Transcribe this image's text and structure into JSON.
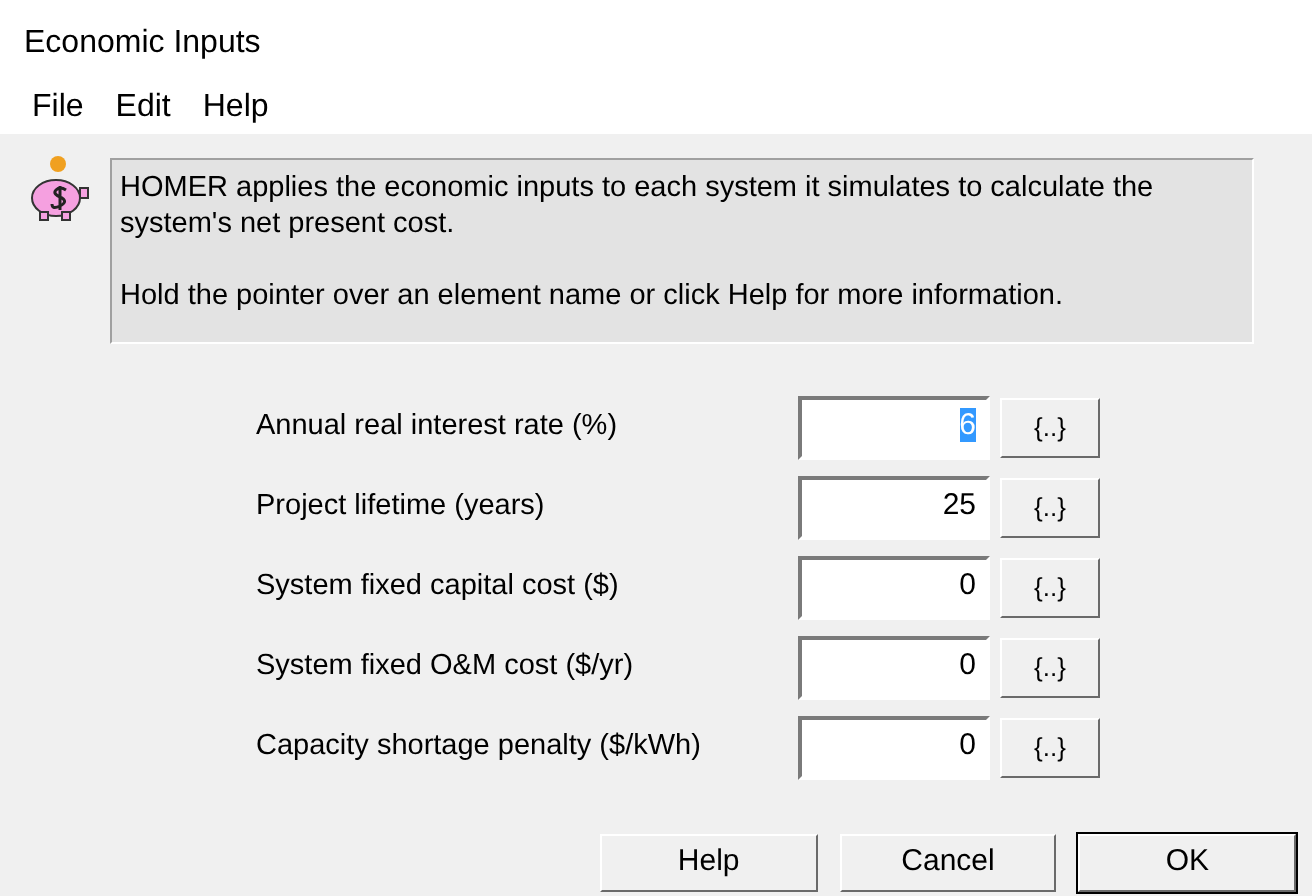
{
  "window": {
    "title": "Economic Inputs"
  },
  "menu": [
    "File",
    "Edit",
    "Help"
  ],
  "info": {
    "paragraphs": [
      "HOMER applies the economic inputs to each system it simulates to calculate the system's net present cost.",
      "Hold the pointer over an element name or click Help for more information."
    ]
  },
  "fields": [
    {
      "label": "Annual real interest rate (%)",
      "value": "6",
      "selected": true,
      "button": "{..}"
    },
    {
      "label": "Project lifetime (years)",
      "value": "25",
      "selected": false,
      "button": "{..}"
    },
    {
      "label": "System fixed capital cost ($)",
      "value": "0",
      "selected": false,
      "button": "{..}"
    },
    {
      "label": "System fixed O&M cost ($/yr)",
      "value": "0",
      "selected": false,
      "button": "{..}"
    },
    {
      "label": "Capacity shortage penalty ($/kWh)",
      "value": "0",
      "selected": false,
      "button": "{..}"
    }
  ],
  "buttons": [
    {
      "label": "Help",
      "default": false
    },
    {
      "label": "Cancel",
      "default": false
    },
    {
      "label": "OK",
      "default": true
    }
  ]
}
